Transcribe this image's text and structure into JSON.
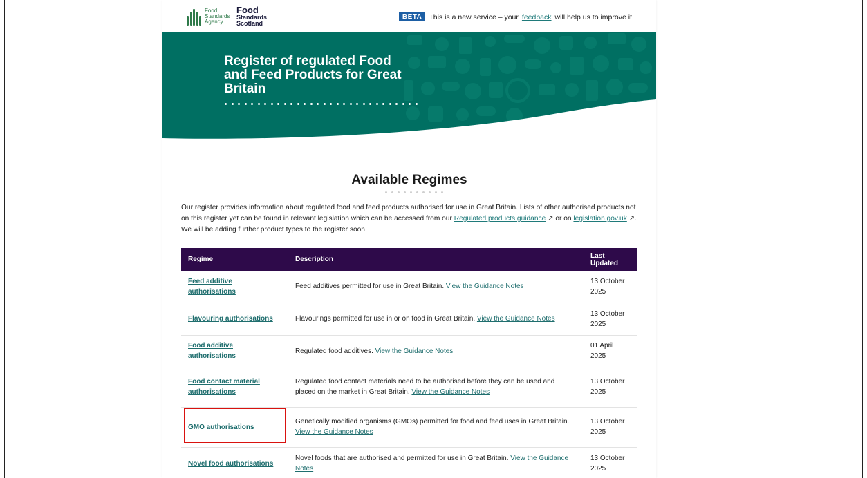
{
  "header": {
    "fsa_logo_text": [
      "Food",
      "Standards",
      "Agency"
    ],
    "fss_logo_text": [
      "Food",
      "Standards",
      "Scotland"
    ],
    "beta_tag": "BETA",
    "beta_text_before": "This is a new service – your",
    "beta_link": "feedback",
    "beta_text_after": "will help us to improve it"
  },
  "hero": {
    "title": "Register of regulated Food and Feed Products for Great Britain",
    "accent_color": "#006f62"
  },
  "main": {
    "heading": "Available Regimes",
    "intro_part1": "Our register provides information about regulated food and feed products authorised for use in Great Britain. Lists of other authorised products not on this register yet can be found in relevant legislation which can be accessed from our",
    "intro_link1": "Regulated products guidance",
    "intro_part2": "or on",
    "intro_link2": "legislation.gov.uk",
    "intro_part3": ". We will be adding further product types to the register soon.",
    "external_icon": "external-link-icon"
  },
  "table": {
    "header_color": "#2e0a4a",
    "columns": [
      "Regime",
      "Description",
      "Last Updated"
    ],
    "guidance_link": "View the Guidance Notes",
    "rows": [
      {
        "regime": "Feed additive authorisations",
        "description": "Feed additives permitted for use in Great Britain.",
        "updated": "13 October 2025"
      },
      {
        "regime": "Flavouring authorisations",
        "description": "Flavourings permitted for use in or on food in Great Britain.",
        "updated": "13 October 2025"
      },
      {
        "regime": "Food additive authorisations",
        "description": "Regulated food additives.",
        "updated": "01 April 2025"
      },
      {
        "regime": "Food contact material authorisations",
        "description": "Regulated food contact materials need to be authorised before they can be used and placed on the market in Great Britain.",
        "updated": "13 October 2025"
      },
      {
        "regime": "GMO authorisations",
        "description": "Genetically modified organisms (GMOs) permitted for food and feed uses in Great Britain.",
        "updated": "13 October 2025"
      },
      {
        "regime": "Novel food authorisations",
        "description": "Novel foods that are authorised and permitted for use in Great Britain.",
        "updated": "13 October 2025"
      }
    ]
  },
  "annotation": {
    "highlight_color": "#d9120f"
  }
}
